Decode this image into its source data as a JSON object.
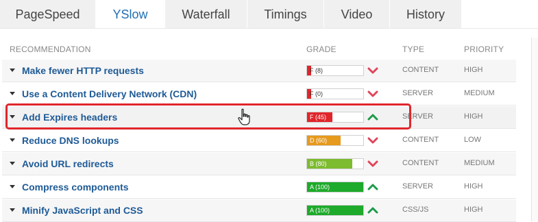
{
  "tabs": [
    {
      "label": "PageSpeed"
    },
    {
      "label": "YSlow"
    },
    {
      "label": "Waterfall"
    },
    {
      "label": "Timings"
    },
    {
      "label": "Video"
    },
    {
      "label": "History"
    }
  ],
  "active_tab": "YSlow",
  "table": {
    "headers": {
      "recommendation": "RECOMMENDATION",
      "grade": "GRADE",
      "type": "TYPE",
      "priority": "PRIORITY"
    },
    "rows": [
      {
        "label": "Make fewer HTTP requests",
        "grade_text": "F (8)",
        "grade_value": 8,
        "grade_color": "#e0262b",
        "trend": "down",
        "type": "CONTENT",
        "priority": "HIGH"
      },
      {
        "label": "Use a Content Delivery Network (CDN)",
        "grade_text": "F (0)",
        "grade_value": 0,
        "grade_color": "#e0262b",
        "trend": "down",
        "type": "SERVER",
        "priority": "MEDIUM"
      },
      {
        "label": "Add Expires headers",
        "grade_text": "F (45)",
        "grade_value": 45,
        "grade_color": "#e0262b",
        "trend": "up",
        "type": "SERVER",
        "priority": "HIGH"
      },
      {
        "label": "Reduce DNS lookups",
        "grade_text": "D (60)",
        "grade_value": 60,
        "grade_color": "#e69a1e",
        "trend": "down",
        "type": "CONTENT",
        "priority": "LOW"
      },
      {
        "label": "Avoid URL redirects",
        "grade_text": "B (80)",
        "grade_value": 80,
        "grade_color": "#7dbb2f",
        "trend": "down",
        "type": "CONTENT",
        "priority": "MEDIUM"
      },
      {
        "label": "Compress components",
        "grade_text": "A (100)",
        "grade_value": 100,
        "grade_color": "#1eaa2a",
        "trend": "up",
        "type": "SERVER",
        "priority": "HIGH"
      },
      {
        "label": "Minify JavaScript and CSS",
        "grade_text": "A (100)",
        "grade_value": 100,
        "grade_color": "#1eaa2a",
        "trend": "up",
        "type": "CSS/JS",
        "priority": "HIGH"
      }
    ]
  },
  "colors": {
    "trend_down": "#e0455a",
    "trend_up": "#1e9a4a",
    "link": "#1e5a96",
    "highlight": "#e0262b"
  }
}
